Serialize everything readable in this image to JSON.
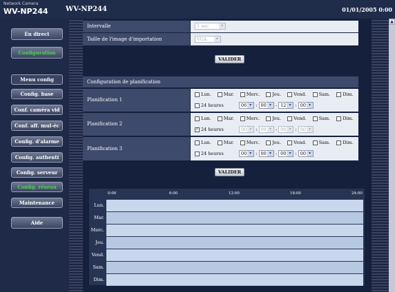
{
  "header": {
    "brand_small": "Network Camera",
    "brand_model": "WV-NP244",
    "model_title": "WV-NP244",
    "datetime": "01/01/2005  0:00"
  },
  "sidebar": {
    "live": "En direct",
    "config": "Configuration",
    "menu_header": "Menu config",
    "items": [
      "Config. base",
      "Conf. caméra vid",
      "Conf. aff. mul-éc",
      "Config. d'alarme",
      "Config. authenti",
      "Config. serveur",
      "Config. réseau",
      "Maintenance",
      "Aide"
    ],
    "active_color": "#4cd64c"
  },
  "upload": {
    "interval_label": "Intervalle",
    "interval_value": "1 sec",
    "size_label": "Taille de l'image d'importation",
    "size_value": "VGA",
    "submit": "VALIDER"
  },
  "schedule": {
    "title": "Configuration de planification",
    "days": [
      "Lun.",
      "Mar.",
      "Merc.",
      "Jeu.",
      "Vend.",
      "Sam.",
      "Dim."
    ],
    "allday_label": "24 heures",
    "rows": [
      {
        "label": "Planification 1",
        "allday": false,
        "start_h": "06",
        "start_m": "00",
        "end_h": "12",
        "end_m": "00",
        "enabled": true
      },
      {
        "label": "Planification 2",
        "allday": true,
        "start_h": "00",
        "start_m": "00",
        "end_h": "00",
        "end_m": "00",
        "enabled": false
      },
      {
        "label": "Planification 3",
        "allday": false,
        "start_h": "00",
        "start_m": "00",
        "end_h": "00",
        "end_m": "00",
        "enabled": true
      }
    ],
    "submit": "VALIDER"
  },
  "timeline": {
    "ticks": [
      "0:00",
      "6:00",
      "12:00",
      "18:00",
      "24:00"
    ],
    "days": [
      "Lun.",
      "Mar.",
      "Merc.",
      "Jeu.",
      "Vend.",
      "Sam.",
      "Dim."
    ]
  },
  "icons": {
    "scroll_up": "scroll-up-arrow-icon",
    "dropdown": "chevron-down-icon"
  }
}
